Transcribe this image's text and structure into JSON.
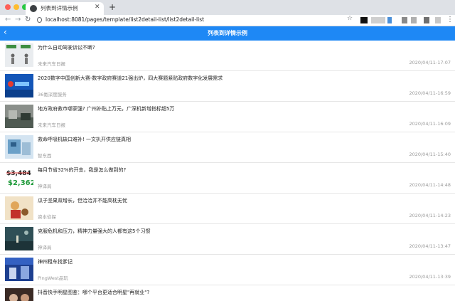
{
  "browser": {
    "tab_title": "列表到详情示例",
    "url": "localhost:8081/pages/template/list2detail-list/list2detail-list"
  },
  "app": {
    "title": "列表到详情示例"
  },
  "colors": {
    "header": "#1e88f5",
    "meta_text": "#999999"
  },
  "items": [
    {
      "title": "为什么自动驾驶诉讼不断?",
      "source": "未来汽车日报",
      "time": "2020/04/11-17:07"
    },
    {
      "title": "2020数字中国创新大赛-数字政府赛道21强出炉，四大赛题紧贴政府数字化发展需求",
      "source": "36氪深度服务",
      "time": "2020/04/11-16:59"
    },
    {
      "title": "地方政府救市哪家强? 广州补贴上万元，广深机新增指标超5万",
      "source": "未来汽车日报",
      "time": "2020/04/11-16:09"
    },
    {
      "title": "救命呼吸机缺口难补! 一文扒开供应链真相",
      "source": "智东西",
      "time": "2020/04/11-15:40"
    },
    {
      "title": "每月节省32%的开支，我是怎么做到的?",
      "source": "神译局",
      "time": "2020/04/11-14:48"
    },
    {
      "title": "瓜子坚果双增长，但洽洽并不能高枕无忧",
      "source": "资本侦探",
      "time": "2020/04/11-14:23"
    },
    {
      "title": "克服危机和压力，精神力量强大的人都有这5个习惯",
      "source": "神译局",
      "time": "2020/04/11-13:47"
    },
    {
      "title": "神州租车找爹记",
      "source": "PingWest品玩",
      "time": "2020/04/11-13:39"
    },
    {
      "title": "抖音快手明星图鉴：哪个平台更适合明星\"再就业\"?",
      "source": "",
      "time": ""
    }
  ]
}
